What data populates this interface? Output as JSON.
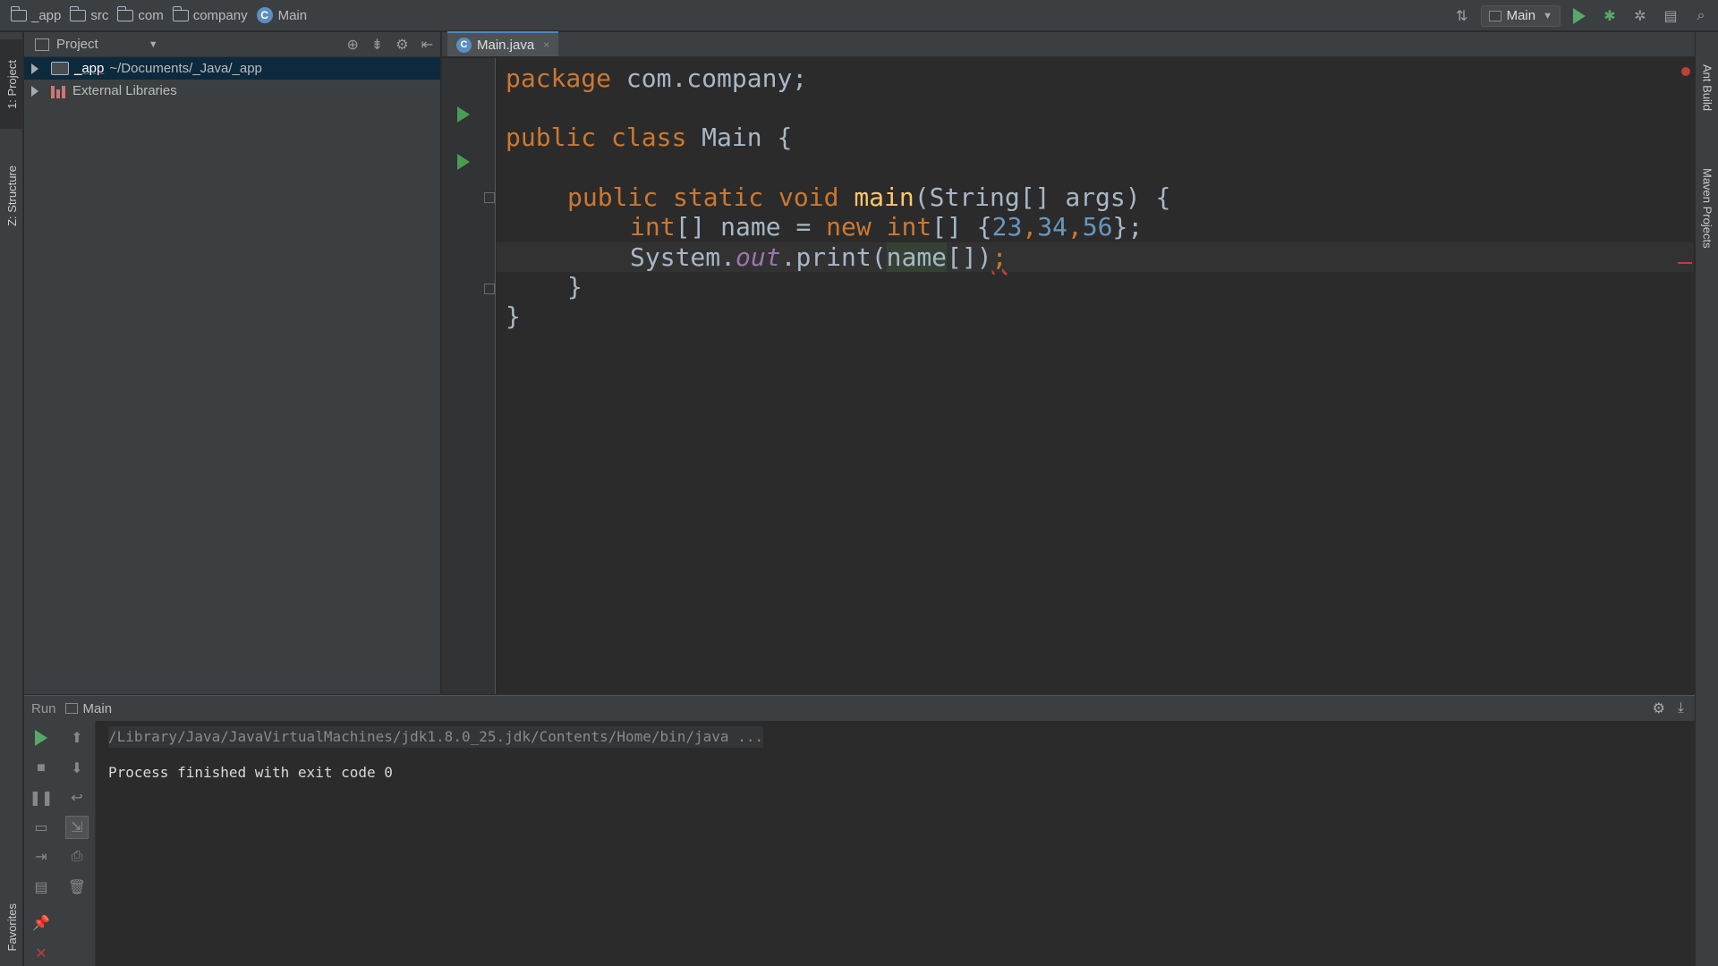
{
  "breadcrumbs": [
    {
      "label": "_app",
      "icon": "folder-icon"
    },
    {
      "label": "src",
      "icon": "folder-icon"
    },
    {
      "label": "com",
      "icon": "folder-icon"
    },
    {
      "label": "company",
      "icon": "folder-icon"
    },
    {
      "label": "Main",
      "icon": "class-icon"
    }
  ],
  "toolbar": {
    "run_config_label": "Main",
    "accent_run_color": "#59a869"
  },
  "left_strip": {
    "project_tab": "1: Project",
    "structure_tab": "Z: Structure",
    "favorites_tab": "Favorites"
  },
  "right_strip": {
    "ant_tab": "Ant Build",
    "maven_tab": "Maven Projects"
  },
  "project_panel": {
    "view_label": "Project",
    "tree": [
      {
        "name": "_app",
        "path": "~/Documents/_Java/_app"
      },
      {
        "name": "External Libraries",
        "path": ""
      }
    ]
  },
  "editor": {
    "tab_label": "Main.java",
    "tab_close": "×",
    "class_icon_letter": "C"
  },
  "code": {
    "lines": [
      [
        "package",
        " com.company;"
      ],
      [
        "public",
        " ",
        "class",
        " Main {"
      ],
      [
        "public",
        " ",
        "static",
        " ",
        "void",
        " ",
        "main",
        "(String[] args) {"
      ],
      [
        "int",
        "[] name = ",
        "new",
        " ",
        "int",
        "[] {",
        "23",
        ",",
        "34",
        ",",
        "56",
        "};"
      ],
      [
        "System.",
        "out",
        ".print(",
        "name",
        "[])",
        ";"
      ],
      [
        "}"
      ],
      [
        "}"
      ]
    ]
  },
  "run_panel": {
    "title": "Run",
    "config": "Main",
    "command": "/Library/Java/JavaVirtualMachines/jdk1.8.0_25.jdk/Contents/Home/bin/java ...",
    "exit_message": "Process finished with exit code 0"
  }
}
